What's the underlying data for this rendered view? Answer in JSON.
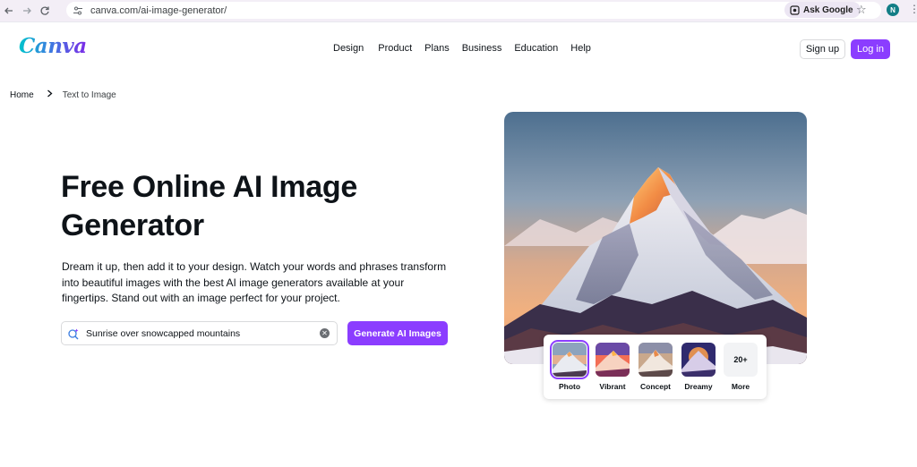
{
  "browser": {
    "url": "canva.com/ai-image-generator/",
    "ask_google": "Ask Google",
    "profile_initial": "N"
  },
  "header": {
    "nav": [
      "Design",
      "Product",
      "Plans",
      "Business",
      "Education",
      "Help"
    ],
    "signup_label": "Sign up",
    "login_label": "Log in"
  },
  "breadcrumb": {
    "home": "Home",
    "current": "Text to Image"
  },
  "hero": {
    "title_line1": "Free Online AI Image",
    "title_line2": "Generator",
    "desc_line1": "Dream it up, then add it to your design. Watch your words and phrases transform",
    "desc_line2": "into beautiful images with the best AI image generators available at your",
    "desc_line3": "fingertips. Stand out with an image perfect for your project.",
    "prompt_value": "Sunrise over snowcapped mountains",
    "generate_label": "Generate AI Images"
  },
  "styles": {
    "items": [
      "Photo",
      "Vibrant",
      "Concept",
      "Dreamy"
    ],
    "more_badge": "20+",
    "more_label": "More",
    "selected": "Photo"
  },
  "colors": {
    "accent": "#8b3dff",
    "browser_bar": "#f3eef6",
    "text": "#0e1318"
  }
}
